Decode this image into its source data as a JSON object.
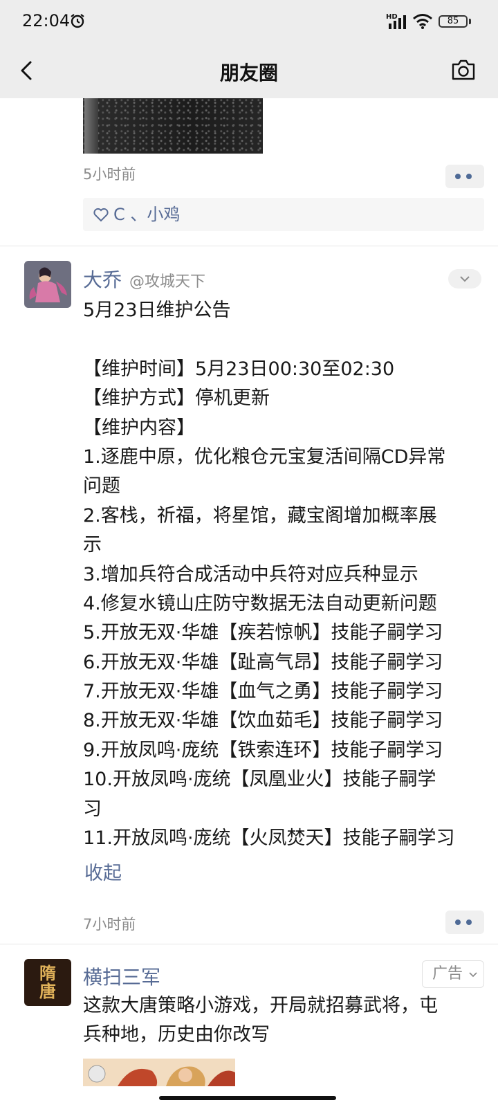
{
  "status_bar": {
    "time": "22:04",
    "network_label": "HD",
    "battery": "85"
  },
  "header": {
    "title": "朋友圈"
  },
  "post1": {
    "time": "5小时前",
    "likes": "C 、小鸡"
  },
  "post2": {
    "author": "大乔",
    "tag": "@攻城天下",
    "lines": [
      "5月23日维护公告",
      "",
      "【维护时间】5月23日00:30至02:30",
      "【维护方式】停机更新",
      "【维护内容】",
      "1.逐鹿中原，优化粮仓元宝复活间隔CD异常",
      "问题",
      "2.客栈，祈福，将星馆，藏宝阁增加概率展",
      "示",
      "3.增加兵符合成活动中兵符对应兵种显示",
      "4.修复水镜山庄防守数据无法自动更新问题",
      "5.开放无双·华雄【疾若惊帆】技能子嗣学习",
      "6.开放无双·华雄【趾高气昂】技能子嗣学习",
      "7.开放无双·华雄【血气之勇】技能子嗣学习",
      "8.开放无双·华雄【饮血茹毛】技能子嗣学习",
      "9.开放凤鸣·庞统【铁索连环】技能子嗣学习",
      "10.开放凤鸣·庞统【凤凰业火】技能子嗣学",
      "习",
      "11.开放凤鸣·庞统【火凤焚天】技能子嗣学习"
    ],
    "collapse_label": "收起",
    "time": "7小时前"
  },
  "post3": {
    "author": "横扫三军",
    "avatar_text": "隋唐",
    "ad_label": "广告",
    "text_lines": [
      "这款大唐策略小游戏，开局就招募武将，屯",
      "兵种地，历史由你改写"
    ]
  },
  "colors": {
    "link": "#576b95",
    "nav_bg": "#ededed",
    "meta": "#8c8c8c"
  }
}
